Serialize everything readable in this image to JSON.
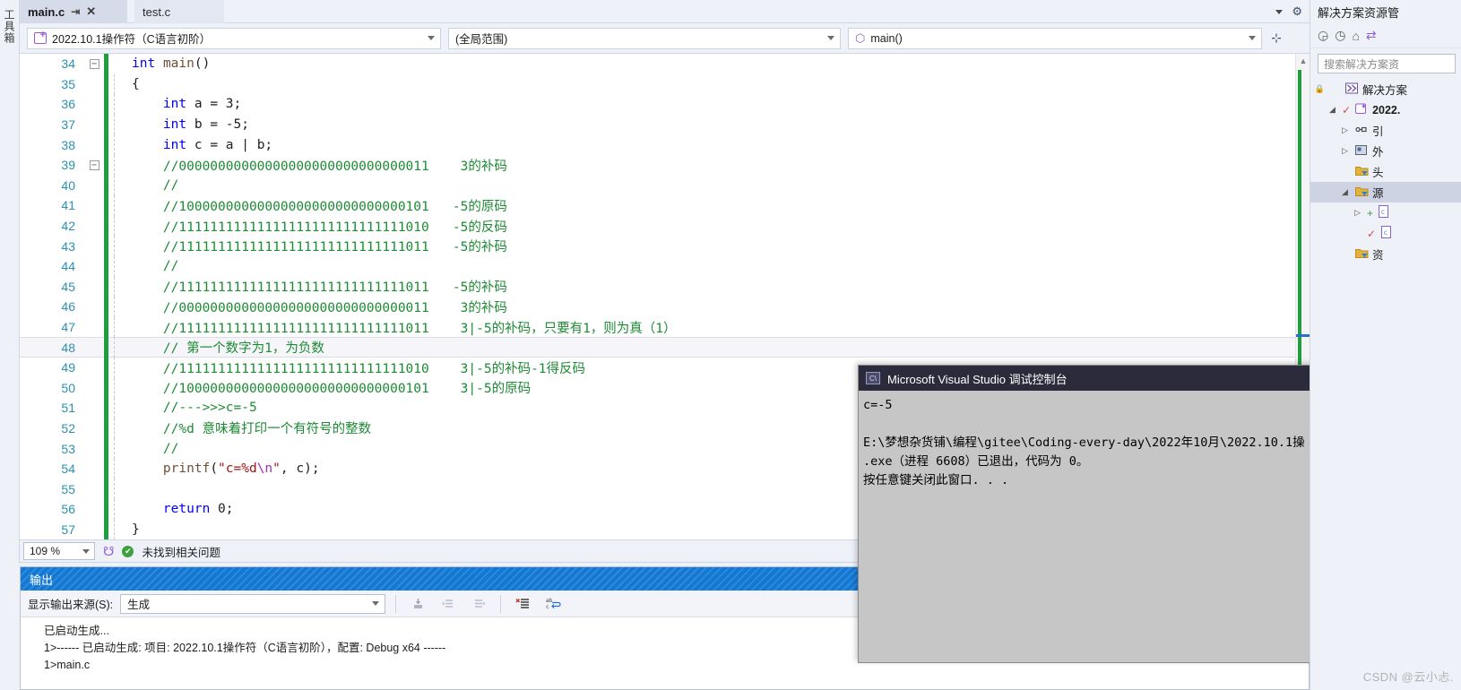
{
  "toolbox": {
    "label": "工具箱"
  },
  "tabs": [
    {
      "label": "main.c",
      "active": true,
      "pin_icon": "pin-icon",
      "close_icon": "close-icon"
    },
    {
      "label": "test.c",
      "active": false
    }
  ],
  "navbar": {
    "project": "2022.10.1操作符（C语言初阶）",
    "scope": "(全局范围)",
    "member": "main()",
    "project_icon": "project-icon",
    "member_icon": "cube-icon",
    "splitter_icon": "split-window-icon"
  },
  "editor": {
    "lines": [
      {
        "num": "34",
        "fold": "minus",
        "change": true,
        "indent": false,
        "html": "<span class=\"k\">int</span> <span class=\"fn\">main</span><span class=\"pl\">()</span>"
      },
      {
        "num": "35",
        "fold": "",
        "change": true,
        "indent": true,
        "html": "<span class=\"pl\">{</span>"
      },
      {
        "num": "36",
        "fold": "",
        "change": true,
        "indent": true,
        "html": "    <span class=\"k\">int</span> <span class=\"pl\">a = </span><span class=\"pl\">3;</span>"
      },
      {
        "num": "37",
        "fold": "",
        "change": true,
        "indent": true,
        "html": "    <span class=\"k\">int</span> <span class=\"pl\">b = -5;</span>"
      },
      {
        "num": "38",
        "fold": "",
        "change": true,
        "indent": true,
        "html": "    <span class=\"k\">int</span> <span class=\"pl\">c = a | b;</span>"
      },
      {
        "num": "39",
        "fold": "minus",
        "change": true,
        "indent": true,
        "html": "    <span class=\"cm\">//00000000000000000000000000000011    3的补码</span>"
      },
      {
        "num": "40",
        "fold": "",
        "change": true,
        "indent": true,
        "html": "    <span class=\"cm\">//</span>"
      },
      {
        "num": "41",
        "fold": "",
        "change": true,
        "indent": true,
        "html": "    <span class=\"cm\">//10000000000000000000000000000101   -5的原码</span>"
      },
      {
        "num": "42",
        "fold": "",
        "change": true,
        "indent": true,
        "html": "    <span class=\"cm\">//11111111111111111111111111111010   -5的反码</span>"
      },
      {
        "num": "43",
        "fold": "",
        "change": true,
        "indent": true,
        "html": "    <span class=\"cm\">//11111111111111111111111111111011   -5的补码</span>"
      },
      {
        "num": "44",
        "fold": "",
        "change": true,
        "indent": true,
        "html": "    <span class=\"cm\">//</span>"
      },
      {
        "num": "45",
        "fold": "",
        "change": true,
        "indent": true,
        "html": "    <span class=\"cm\">//11111111111111111111111111111011   -5的补码</span>"
      },
      {
        "num": "46",
        "fold": "",
        "change": true,
        "indent": true,
        "html": "    <span class=\"cm\">//00000000000000000000000000000011    3的补码</span>"
      },
      {
        "num": "47",
        "fold": "",
        "change": true,
        "indent": true,
        "html": "    <span class=\"cm\">//11111111111111111111111111111011    3|-5的补码，只要有1，则为真（1）</span>"
      },
      {
        "num": "48",
        "fold": "",
        "change": true,
        "indent": true,
        "highlight": true,
        "html": "    <span class=\"cm\">// 第一个数字为1，为负数</span>"
      },
      {
        "num": "49",
        "fold": "",
        "change": true,
        "indent": true,
        "html": "    <span class=\"cm\">//11111111111111111111111111111010    3|-5的补码-1得反码</span>"
      },
      {
        "num": "50",
        "fold": "",
        "change": true,
        "indent": true,
        "html": "    <span class=\"cm\">//10000000000000000000000000000101    3|-5的原码</span>"
      },
      {
        "num": "51",
        "fold": "",
        "change": true,
        "indent": true,
        "html": "    <span class=\"cm\">//---&gt;&gt;&gt;c=-5</span>"
      },
      {
        "num": "52",
        "fold": "",
        "change": true,
        "indent": true,
        "html": "    <span class=\"cm\">//%d 意味着打印一个有符号的整数</span>"
      },
      {
        "num": "53",
        "fold": "",
        "change": true,
        "indent": true,
        "html": "    <span class=\"cm\">//</span>"
      },
      {
        "num": "54",
        "fold": "",
        "change": true,
        "indent": true,
        "html": "    <span class=\"fn\">printf</span><span class=\"pl\">(</span><span class=\"st\">\"c=%d</span><span class=\"es\">\\n</span><span class=\"st\">\"</span><span class=\"pl\">, c);</span>"
      },
      {
        "num": "55",
        "fold": "",
        "change": true,
        "indent": true,
        "html": ""
      },
      {
        "num": "56",
        "fold": "",
        "change": true,
        "indent": true,
        "html": "    <span class=\"k\">return</span> <span class=\"pl\">0;</span>"
      },
      {
        "num": "57",
        "fold": "",
        "change": true,
        "indent": true,
        "html": "<span class=\"pl\">}</span>"
      }
    ]
  },
  "editor_status": {
    "zoom": "109 %",
    "intelli_icon": "intellicode-icon",
    "ok_icon": "check-circle-icon",
    "message": "未找到相关问题"
  },
  "output": {
    "title": "输出",
    "source_label": "显示输出来源(S):",
    "source_value": "生成",
    "toolbar_icons": [
      "jump-to-icon",
      "previous-message-icon",
      "next-message-icon",
      "clear-all-icon",
      "toggle-word-wrap-icon"
    ],
    "lines": [
      "已启动生成...",
      "1>------ 已启动生成: 项目: 2022.10.1操作符（C语言初阶），配置: Debug x64 ------",
      "1>main.c"
    ]
  },
  "console": {
    "title": "Microsoft Visual Studio 调试控制台",
    "icon": "console-icon",
    "lines": [
      "c=-5",
      "",
      "E:\\梦想杂货铺\\编程\\gitee\\Coding-every-day\\2022年10月\\2022.10.1操",
      ".exe（进程 6608）已退出，代码为 0。",
      "按任意键关闭此窗口. . ."
    ]
  },
  "solution_explorer": {
    "title": "解决方案资源管",
    "toolbar_icons": [
      "back-icon",
      "forward-icon",
      "home-icon",
      "sync-icon"
    ],
    "search_placeholder": "搜索解决方案资",
    "tree": [
      {
        "indent": 0,
        "twisty": "",
        "icon": "solution-icon",
        "label": "解决方案",
        "bold": false,
        "lock": true
      },
      {
        "indent": 1,
        "twisty": "down",
        "icon": "project-icon",
        "label": "2022.",
        "bold": true,
        "check": true
      },
      {
        "indent": 2,
        "twisty": "right",
        "icon": "references-icon",
        "label": "引",
        "bold": false
      },
      {
        "indent": 2,
        "twisty": "right",
        "icon": "external-deps-icon",
        "label": "外",
        "bold": false
      },
      {
        "indent": 2,
        "twisty": "",
        "icon": "folder-filter-icon",
        "label": "头",
        "bold": false
      },
      {
        "indent": 2,
        "twisty": "down",
        "icon": "folder-filter-icon",
        "label": "源",
        "bold": false,
        "selected": true
      },
      {
        "indent": 3,
        "twisty": "right",
        "icon": "c-file-icon",
        "label": "",
        "bold": false,
        "plus": true
      },
      {
        "indent": 3,
        "twisty": "",
        "icon": "c-file-icon",
        "label": "",
        "bold": false,
        "check": true
      },
      {
        "indent": 2,
        "twisty": "",
        "icon": "folder-filter-icon",
        "label": "资",
        "bold": false
      }
    ]
  },
  "window_chrome": {
    "tab_overflow_icon": "chevron-down-icon",
    "settings_icon": "gear-icon"
  },
  "watermark": "CSDN @云小忐."
}
